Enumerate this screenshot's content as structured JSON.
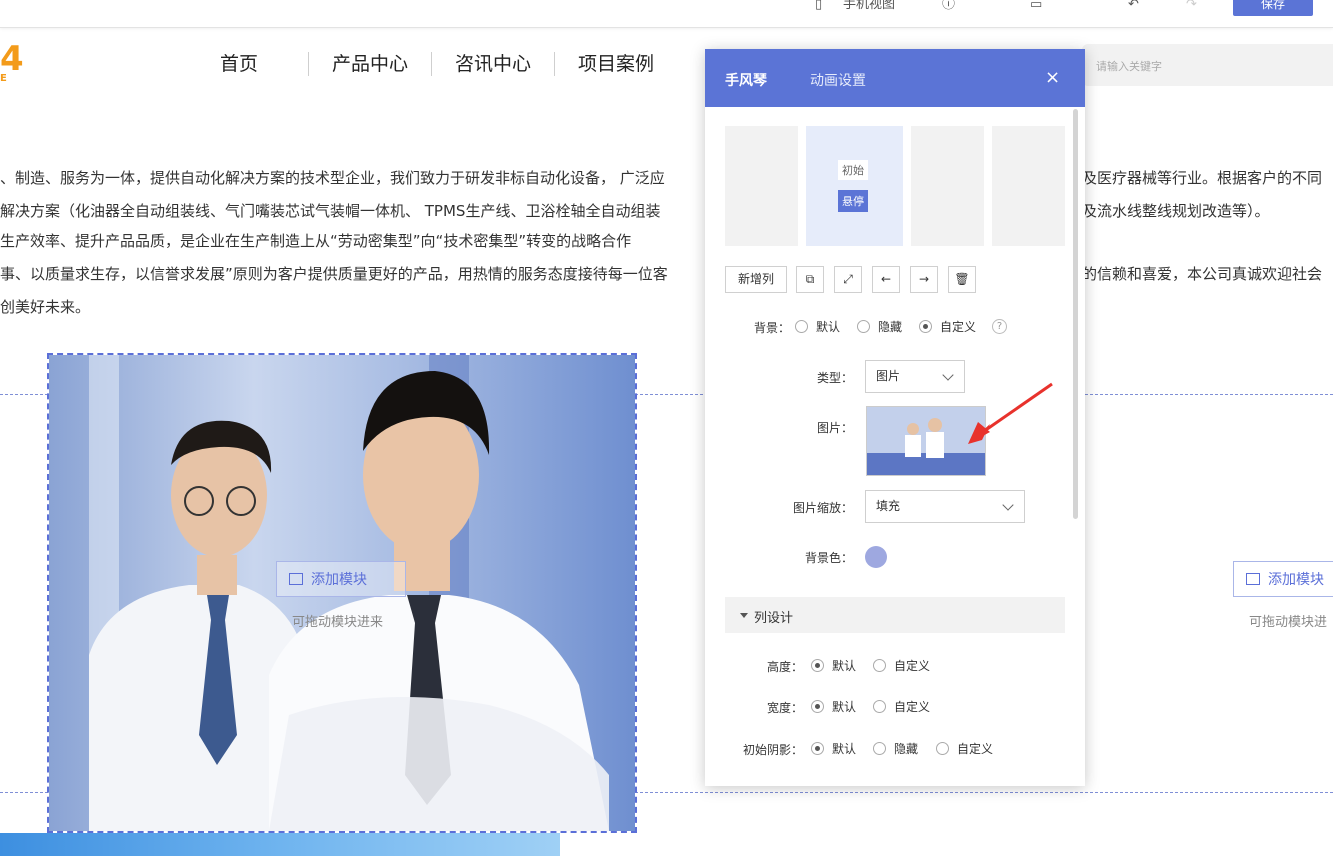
{
  "toolbar": {
    "item1": "手机视图",
    "save_label": "保存"
  },
  "logo": {
    "mark": "4",
    "sub": "E"
  },
  "nav": [
    "首页",
    "产品中心",
    "咨讯中心",
    "项目案例"
  ],
  "search": {
    "placeholder": "请输入关键字"
  },
  "content": {
    "line1": "、制造、服务为一体，提供自动化解决方案的技术型企业，我们致力于研发非标自动化设备， 广泛应",
    "line1_right": "及医疗器械等行业。根据客户的不同",
    "line2": "解决方案（化油器全自动组装线、气门嘴装芯试气装帽一体机、 TPMS生产线、卫浴栓轴全自动组装",
    "line2_right": "及流水线整线规划改造等）。",
    "line3": "生产效率、提升产品品质，是企业在生产制造上从“劳动密集型”向“技术密集型”转变的战略合作",
    "line4": "事、以质量求生存，以信誉求发展”原则为客户提供质量更好的产品，用热情的服务态度接待每一位客",
    "line4_right": "的信赖和喜爱，本公司真诚欢迎社会",
    "line5": "创美好未来。"
  },
  "modules": {
    "add_label": "添加模块",
    "drag_hint": "可拖动模块进来",
    "add_label_right": "添加模块",
    "drag_hint_right": "可拖动模块进"
  },
  "panel": {
    "tab1": "手风琴",
    "tab2": "动画设置",
    "close": "×",
    "state_initial": "初始",
    "state_hover": "悬停",
    "new_column": "新增列",
    "bg_label": "背景：",
    "bg_options": [
      "默认",
      "隐藏",
      "自定义"
    ],
    "help": "?",
    "type_label": "类型：",
    "type_value": "图片",
    "image_label": "图片：",
    "scale_label": "图片缩放：",
    "scale_value": "填充",
    "bgcolor_label": "背景色：",
    "bgcolor_value": "#9ea8e0",
    "section_title": "列设计",
    "height_label": "高度：",
    "width_label": "宽度：",
    "shadow_label": "初始阴影：",
    "opt_default": "默认",
    "opt_custom": "自定义",
    "opt_hide": "隐藏"
  },
  "colors": {
    "accent": "#5b74d6",
    "arrow": "#e8322c"
  }
}
